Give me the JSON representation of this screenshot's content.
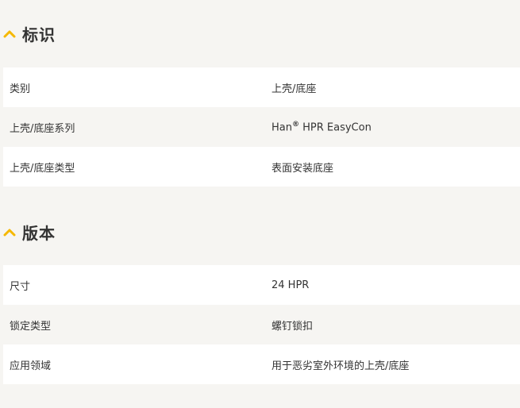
{
  "accent_color": "#f5b800",
  "sections": [
    {
      "title": "标识",
      "rows": [
        {
          "label": "类别",
          "value": "上壳/底座"
        },
        {
          "label": "上壳/底座系列",
          "value_prefix": "Han",
          "value_mark": "®",
          "value_suffix": " HPR EasyCon"
        },
        {
          "label": "上壳/底座类型",
          "value": "表面安装底座"
        }
      ]
    },
    {
      "title": "版本",
      "rows": [
        {
          "label": "尺寸",
          "value": "24 HPR"
        },
        {
          "label": "锁定类型",
          "value": "螺钉锁扣"
        },
        {
          "label": "应用领域",
          "value": "用于恶劣室外环境的上壳/底座"
        }
      ]
    }
  ]
}
